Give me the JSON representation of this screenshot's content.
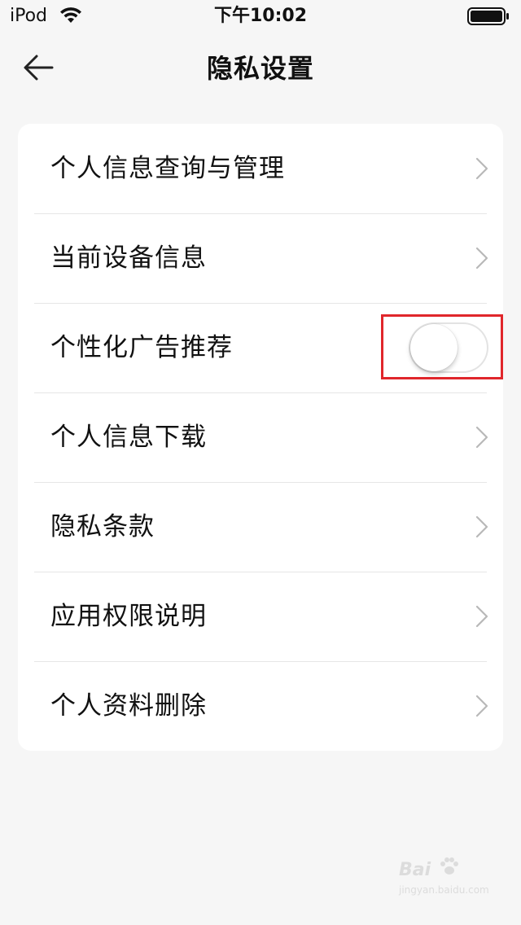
{
  "status_bar": {
    "carrier": "iPod",
    "time": "下午10:02",
    "wifi_icon": "wifi-icon",
    "battery_icon": "battery-icon"
  },
  "nav": {
    "title": "隐私设置",
    "back_icon": "arrow-left-icon"
  },
  "settings": {
    "items": [
      {
        "label": "个人信息查询与管理",
        "control": "chevron"
      },
      {
        "label": "当前设备信息",
        "control": "chevron"
      },
      {
        "label": "个性化广告推荐",
        "control": "toggle",
        "toggle_on": false
      },
      {
        "label": "个人信息下载",
        "control": "chevron"
      },
      {
        "label": "隐私条款",
        "control": "chevron"
      },
      {
        "label": "应用权限说明",
        "control": "chevron"
      },
      {
        "label": "个人资料删除",
        "control": "chevron"
      }
    ]
  },
  "colors": {
    "background": "#f6f6f6",
    "card": "#ffffff",
    "highlight": "#e0262b"
  },
  "watermark": {
    "brand": "Bai",
    "url": "jingyan.baidu.com"
  }
}
